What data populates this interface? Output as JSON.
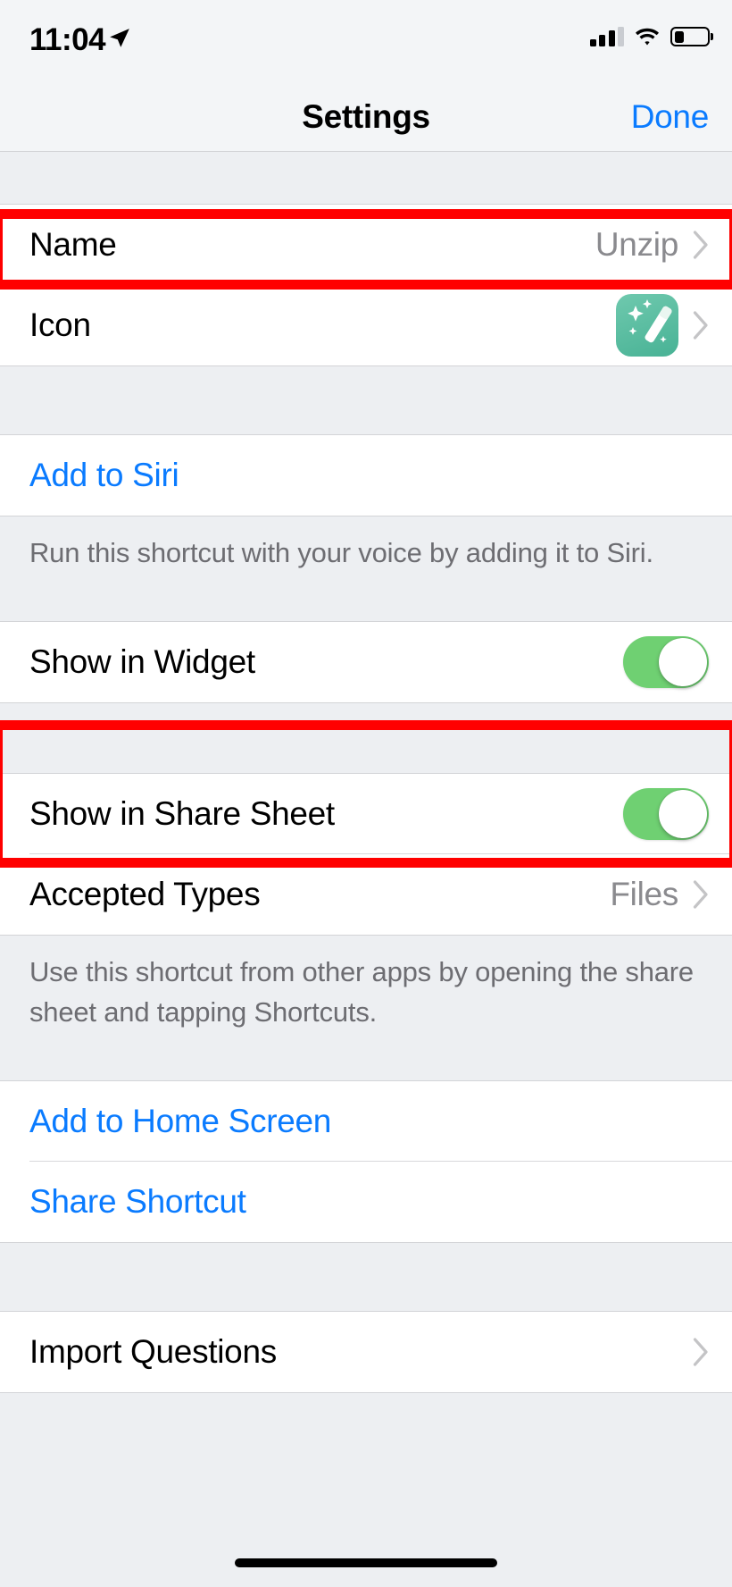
{
  "status_bar": {
    "time": "11:04",
    "location_icon": "location-arrow-icon",
    "signal_icon": "cellular-signal-icon",
    "signal_bars_filled": 3,
    "signal_bars_total": 4,
    "wifi_icon": "wifi-icon",
    "battery_icon": "battery-icon",
    "battery_percent": 30
  },
  "nav": {
    "title": "Settings",
    "done_label": "Done"
  },
  "sections": [
    {
      "rows": [
        {
          "label": "Name",
          "value": "Unzip",
          "accessory": "chevron"
        },
        {
          "label": "Icon",
          "value": "",
          "accessory": "icon-chevron",
          "icon": "magic-wand-icon"
        }
      ],
      "footer": ""
    },
    {
      "rows": [
        {
          "label": "Add to Siri",
          "style": "link",
          "accessory": "none"
        }
      ],
      "footer": "Run this shortcut with your voice by adding it to Siri."
    },
    {
      "rows": [
        {
          "label": "Show in Widget",
          "accessory": "toggle",
          "toggle_on": true
        }
      ],
      "footer": ""
    },
    {
      "rows": [
        {
          "label": "Show in Share Sheet",
          "accessory": "toggle",
          "toggle_on": true
        },
        {
          "label": "Accepted Types",
          "value": "Files",
          "accessory": "chevron"
        }
      ],
      "footer": "Use this shortcut from other apps by opening the share sheet and tapping Shortcuts."
    },
    {
      "rows": [
        {
          "label": "Add to Home Screen",
          "style": "link",
          "accessory": "none"
        },
        {
          "label": "Share Shortcut",
          "style": "link",
          "accessory": "none"
        }
      ],
      "footer": ""
    },
    {
      "rows": [
        {
          "label": "Import Questions",
          "value": "",
          "accessory": "chevron"
        }
      ],
      "footer": ""
    }
  ],
  "annotations": {
    "color": "#FF0000",
    "boxes": [
      {
        "target": "Name",
        "label": "name-row-highlight"
      },
      {
        "target": "Show in Share Sheet / Accepted Types",
        "label": "share-sheet-rows-highlight"
      }
    ]
  },
  "colors": {
    "accent_blue": "#0A7BFF",
    "toggle_on_green": "#6FD072",
    "icon_teal": "#48B295",
    "secondary_text": "#8A8A8E",
    "footer_text": "#6D6D72",
    "group_background": "#FFFFFF",
    "page_background": "#EDEFF2",
    "highlight_red": "#FF0000"
  },
  "home_indicator": "home-indicator"
}
